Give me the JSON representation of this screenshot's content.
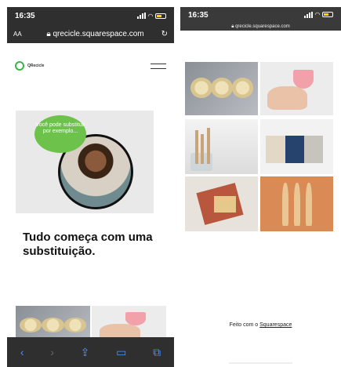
{
  "left": {
    "status": {
      "time": "16:35"
    },
    "url": "qrecicle.squarespace.com",
    "aa": "AA",
    "reload": "↻",
    "brand": "QRecicle",
    "bubble": "Você pode substituir por exemplo...",
    "headline": "Tudo começa com uma substituição.",
    "toolbar": {
      "back": "‹",
      "forward": "›",
      "share": "⇪",
      "bookmarks": "▭",
      "tabs": "⧉"
    }
  },
  "right": {
    "status": {
      "time": "16:35"
    },
    "url": "qrecicle.squarespace.com",
    "footer_prefix": "Feito com o ",
    "footer_link": "Squarespace"
  },
  "colors": {
    "accent": "#6cc24a",
    "chrome": "#2f2f2f",
    "toolbar_icon": "#4f90ff"
  }
}
